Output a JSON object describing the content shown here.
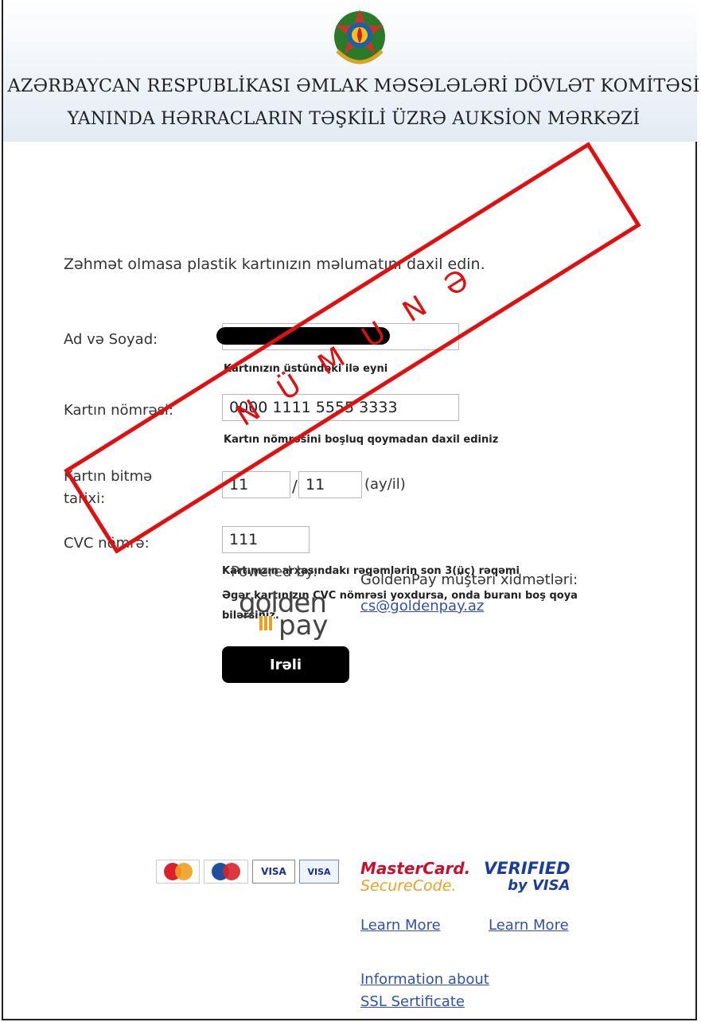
{
  "header": {
    "title_line1": "AZƏRBAYCAN RESPUBLİKASI ƏMLAK MƏSƏLƏLƏRİ DÖVLƏT KOMİTƏSİ",
    "title_line2": "YANINDA HƏRRACLARIN TƏŞKİLİ ÜZRƏ AUKSİON MƏRKƏZİ",
    "emblem_icon": "azerbaijan-emblem-icon"
  },
  "form": {
    "intro": "Zəhmət olmasa plastik kartınızın məlumatını daxil edin.",
    "name_label": "Ad və Soyad:",
    "name_value": "",
    "name_hint": "Kartınızın üstündəki ilə eyni",
    "card_label": "Kartın nömrəsi:",
    "card_value": "0000 1111 5555 3333",
    "card_hint": "Kartın nömrəsini boşluq qoymadan daxil ediniz",
    "expiry_label_line1": "Kartın bitmə",
    "expiry_label_line2": "tarixi:",
    "expiry_month": "11",
    "expiry_separator": "/",
    "expiry_year": "11",
    "expiry_format": "(ay/il)",
    "cvc_label": "CVC nömrə:",
    "cvc_value": "111",
    "cvc_hint1": "Kartınızın arxasındakı rəqəmlərin son 3(üç) rəqəmi",
    "cvc_hint2_line1": "Əgər kartınızın CVC nömrəsi yoxdursa, onda buranı boş qoya",
    "cvc_hint2_line2": "bilərsiniz.",
    "submit_label": "Irəli"
  },
  "footer": {
    "powered_by": "Powered by:",
    "logo_top": "golden",
    "logo_bottom": "pay",
    "support_label": "GoldenPay müştəri xidmətləri:",
    "support_email": "cs@goldenpay.az",
    "card_brands": [
      "maestro",
      "mastercard",
      "VISA",
      "VISA"
    ],
    "mastercard_line1": "MasterCard.",
    "mastercard_line2": "SecureCode.",
    "verified_line1": "VERIFIED",
    "verified_line2": "by VISA",
    "learn_more_mc": "Learn More",
    "learn_more_visa": "Learn More",
    "ssl_line1": "Information about",
    "ssl_line2": "SSL Sertificate"
  },
  "stamp": {
    "text": "NÜMUNƏ",
    "color": "#e01010"
  },
  "colors": {
    "link": "#3050b0",
    "button": "#000000",
    "stamp": "#e01010"
  }
}
